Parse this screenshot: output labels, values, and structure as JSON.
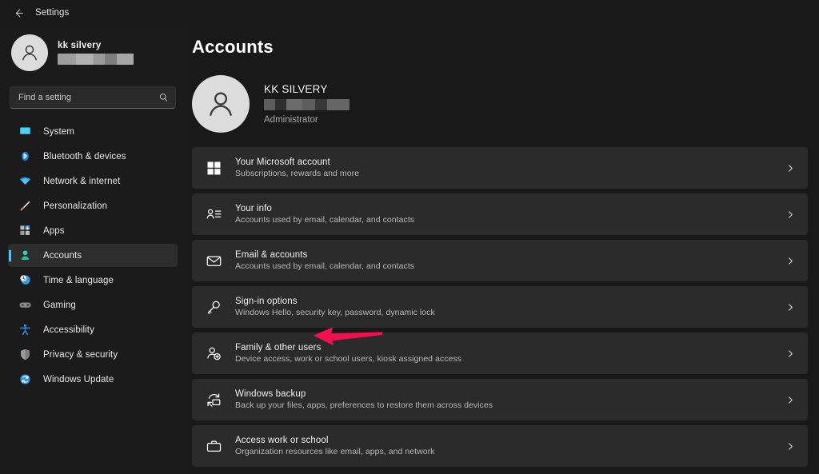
{
  "titlebar": {
    "back_icon": "back-arrow-icon",
    "title": "Settings"
  },
  "sidebar": {
    "profile": {
      "name": "kk silvery",
      "email_redacted": true,
      "avatar_icon": "user-avatar-icon"
    },
    "search": {
      "placeholder": "Find a setting",
      "value": "",
      "icon": "search-icon"
    },
    "items": [
      {
        "label": "System",
        "icon": "monitor-icon",
        "selected": false
      },
      {
        "label": "Bluetooth & devices",
        "icon": "bluetooth-icon",
        "selected": false
      },
      {
        "label": "Network & internet",
        "icon": "wifi-icon",
        "selected": false
      },
      {
        "label": "Personalization",
        "icon": "paintbrush-icon",
        "selected": false
      },
      {
        "label": "Apps",
        "icon": "apps-grid-icon",
        "selected": false
      },
      {
        "label": "Accounts",
        "icon": "person-icon",
        "selected": true
      },
      {
        "label": "Time & language",
        "icon": "clock-globe-icon",
        "selected": false
      },
      {
        "label": "Gaming",
        "icon": "gamepad-icon",
        "selected": false
      },
      {
        "label": "Accessibility",
        "icon": "accessibility-icon",
        "selected": false
      },
      {
        "label": "Privacy & security",
        "icon": "shield-icon",
        "selected": false
      },
      {
        "label": "Windows Update",
        "icon": "update-refresh-icon",
        "selected": false
      }
    ]
  },
  "main": {
    "page_title": "Accounts",
    "account": {
      "name": "KK SILVERY",
      "email_redacted": true,
      "role": "Administrator",
      "avatar_icon": "user-avatar-icon"
    },
    "cards": [
      {
        "title": "Your Microsoft account",
        "subtitle": "Subscriptions, rewards and more",
        "icon": "microsoft-logo-icon",
        "chevron": "chevron-right-icon"
      },
      {
        "title": "Your info",
        "subtitle": "Accounts used by email, calendar, and contacts",
        "icon": "person-list-icon",
        "chevron": "chevron-right-icon"
      },
      {
        "title": "Email & accounts",
        "subtitle": "Accounts used by email, calendar, and contacts",
        "icon": "envelope-icon",
        "chevron": "chevron-right-icon"
      },
      {
        "title": "Sign-in options",
        "subtitle": "Windows Hello, security key, password, dynamic lock",
        "icon": "key-icon",
        "chevron": "chevron-right-icon"
      },
      {
        "title": "Family & other users",
        "subtitle": "Device access, work or school users, kiosk assigned access",
        "icon": "person-add-icon",
        "chevron": "chevron-right-icon"
      },
      {
        "title": "Windows backup",
        "subtitle": "Back up your files, apps, preferences to restore them across devices",
        "icon": "backup-sync-icon",
        "chevron": "chevron-right-icon"
      },
      {
        "title": "Access work or school",
        "subtitle": "Organization resources like email, apps, and network",
        "icon": "briefcase-icon",
        "chevron": "chevron-right-icon"
      }
    ]
  },
  "annotation": {
    "arrow_icon": "pointer-arrow-icon",
    "color": "#f2114f",
    "points_to": "Family & other users"
  },
  "colors": {
    "background": "#191919",
    "sidebar": "#1b1b1b",
    "card": "#2b2b2b",
    "accent": "#4cc2ff",
    "annotation": "#f2114f"
  }
}
